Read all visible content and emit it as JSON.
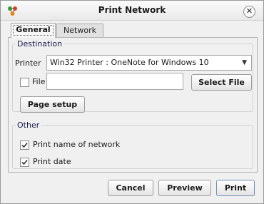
{
  "window": {
    "title": "Print Network",
    "app_icon": "network-nodes-icon",
    "close_icon": "close-icon"
  },
  "tabs": [
    {
      "label": "General",
      "active": true
    },
    {
      "label": "Network",
      "active": false
    }
  ],
  "destination": {
    "group_label": "Destination",
    "printer_label": "Printer",
    "printer_value": "Win32 Printer : OneNote for Windows 10",
    "file_label": "File",
    "file_checked": false,
    "file_path_value": "",
    "select_file_label": "Select File",
    "page_setup_label": "Page setup"
  },
  "other": {
    "group_label": "Other",
    "options": [
      {
        "label": "Print name of network",
        "checked": true
      },
      {
        "label": "Print date",
        "checked": true
      }
    ]
  },
  "footer": {
    "cancel_label": "Cancel",
    "preview_label": "Preview",
    "print_label": "Print"
  },
  "colors": {
    "dialog_bg": "#f0f0f0",
    "legend_text": "#1a1a4d",
    "primary_border": "#6f8fb8"
  }
}
